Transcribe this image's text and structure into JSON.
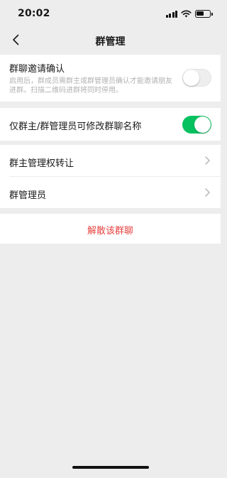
{
  "status_bar": {
    "time": "20:02",
    "icons": [
      "signal-icon",
      "wifi-icon",
      "battery-icon"
    ]
  },
  "nav": {
    "title": "群管理",
    "back_icon": "chevron-left-icon"
  },
  "invite_confirm": {
    "title": "群聊邀请确认",
    "description": "启用后，群成员需群主或群管理员确认才能邀请朋友进群。扫描二维码进群将同时停用。",
    "enabled": false
  },
  "only_admin_rename": {
    "title": "仅群主/群管理员可修改群聊名称",
    "enabled": true
  },
  "menu": [
    {
      "label": "群主管理权转让",
      "icon": "chevron-right-icon"
    },
    {
      "label": "群管理员",
      "icon": "chevron-right-icon"
    }
  ],
  "dissolve": {
    "label": "解散该群聊"
  },
  "colors": {
    "accent_green": "#07c160",
    "danger_red": "#e64340",
    "background": "#ededed"
  }
}
